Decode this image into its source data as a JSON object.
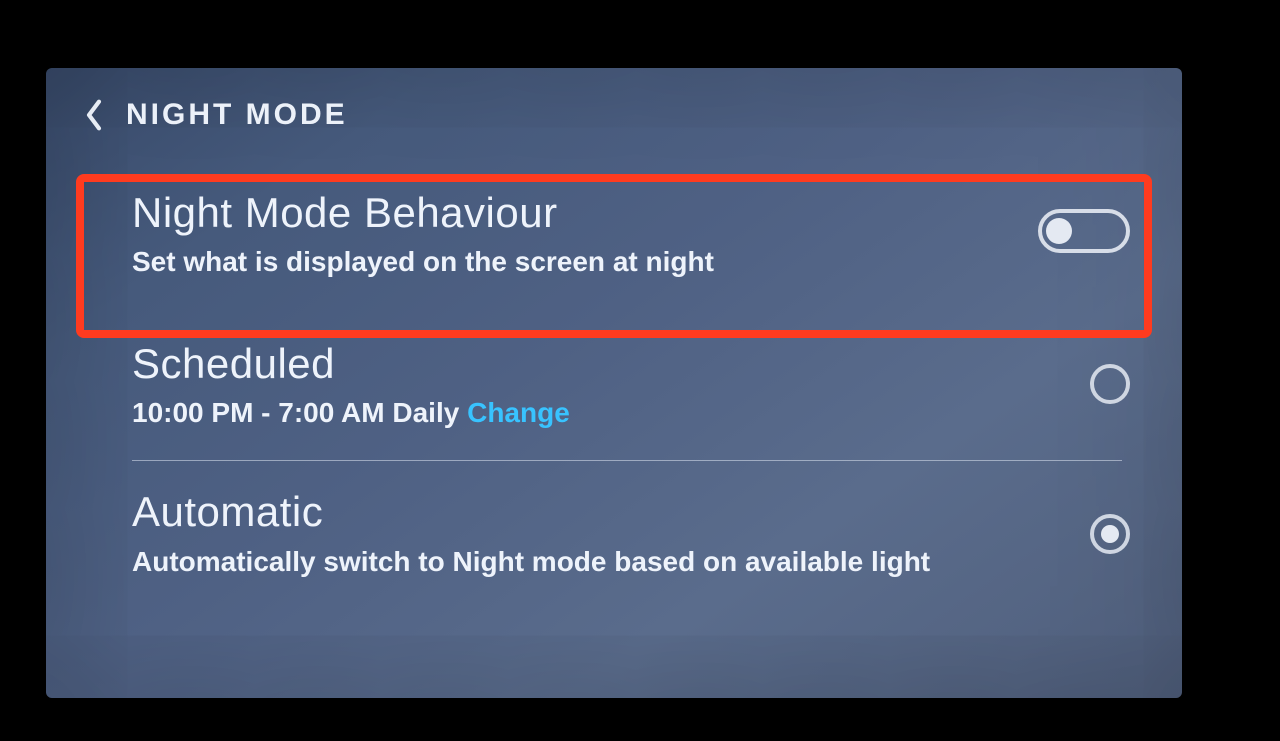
{
  "header": {
    "title": "NIGHT MODE"
  },
  "options": {
    "behaviour": {
      "title": "Night Mode Behaviour",
      "subtitle": "Set what is displayed on the screen at night",
      "toggle_on": false
    },
    "scheduled": {
      "title": "Scheduled",
      "schedule_text": "10:00 PM - 7:00 AM Daily",
      "change_label": "Change",
      "selected": false
    },
    "automatic": {
      "title": "Automatic",
      "subtitle": "Automatically switch to Night mode based on available light",
      "selected": true
    }
  },
  "colors": {
    "highlight": "#ff3b1f",
    "link": "#38c3ff"
  }
}
